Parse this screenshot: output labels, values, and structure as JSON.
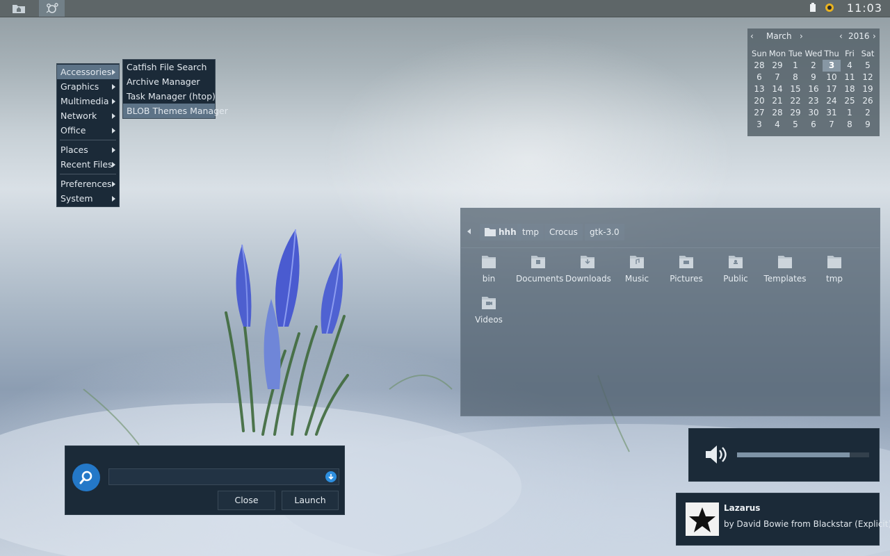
{
  "panel": {
    "clock": "11:03"
  },
  "app_menu": {
    "items": [
      {
        "label": "Accessories"
      },
      {
        "label": "Graphics"
      },
      {
        "label": "Multimedia"
      },
      {
        "label": "Network"
      },
      {
        "label": "Office"
      },
      {
        "label": "Places"
      },
      {
        "label": "Recent Files"
      },
      {
        "label": "Preferences"
      },
      {
        "label": "System"
      }
    ]
  },
  "submenu": {
    "items": [
      {
        "label": "Catfish File Search"
      },
      {
        "label": "Archive Manager"
      },
      {
        "label": "Task Manager (htop)"
      },
      {
        "label": "BLOB Themes Manager"
      }
    ]
  },
  "calendar": {
    "month": "March",
    "year": "2016",
    "day_names": [
      "Sun",
      "Mon",
      "Tue",
      "Wed",
      "Thu",
      "Fri",
      "Sat"
    ],
    "weeks": [
      [
        "28",
        "29",
        "1",
        "2",
        "3",
        "4",
        "5"
      ],
      [
        "6",
        "7",
        "8",
        "9",
        "10",
        "11",
        "12"
      ],
      [
        "13",
        "14",
        "15",
        "16",
        "17",
        "18",
        "19"
      ],
      [
        "20",
        "21",
        "22",
        "23",
        "24",
        "25",
        "26"
      ],
      [
        "27",
        "28",
        "29",
        "30",
        "31",
        "1",
        "2"
      ],
      [
        "3",
        "4",
        "5",
        "6",
        "7",
        "8",
        "9"
      ]
    ],
    "today": "3"
  },
  "file_manager": {
    "breadcrumbs": [
      "hhh",
      "tmp",
      "Crocus",
      "gtk-3.0"
    ],
    "items": [
      {
        "label": "bin",
        "icon": "folder-icon"
      },
      {
        "label": "Documents",
        "icon": "folder-documents-icon"
      },
      {
        "label": "Downloads",
        "icon": "folder-download-icon"
      },
      {
        "label": "Music",
        "icon": "folder-music-icon"
      },
      {
        "label": "Pictures",
        "icon": "folder-pictures-icon"
      },
      {
        "label": "Public",
        "icon": "folder-public-icon"
      },
      {
        "label": "Templates",
        "icon": "folder-templates-icon"
      },
      {
        "label": "tmp",
        "icon": "folder-icon"
      },
      {
        "label": "Videos",
        "icon": "folder-videos-icon"
      }
    ]
  },
  "launcher": {
    "input_value": "",
    "close_label": "Close",
    "launch_label": "Launch"
  },
  "volume": {
    "level": 0.85
  },
  "notification": {
    "title": "Lazarus",
    "body": "by David Bowie from Blackstar (Explicit)"
  },
  "colors": {
    "panel": "#5e6668",
    "dialog_bg": "#1b2a38",
    "accent": "#2478c8",
    "menu_selected": "#5d7387"
  }
}
